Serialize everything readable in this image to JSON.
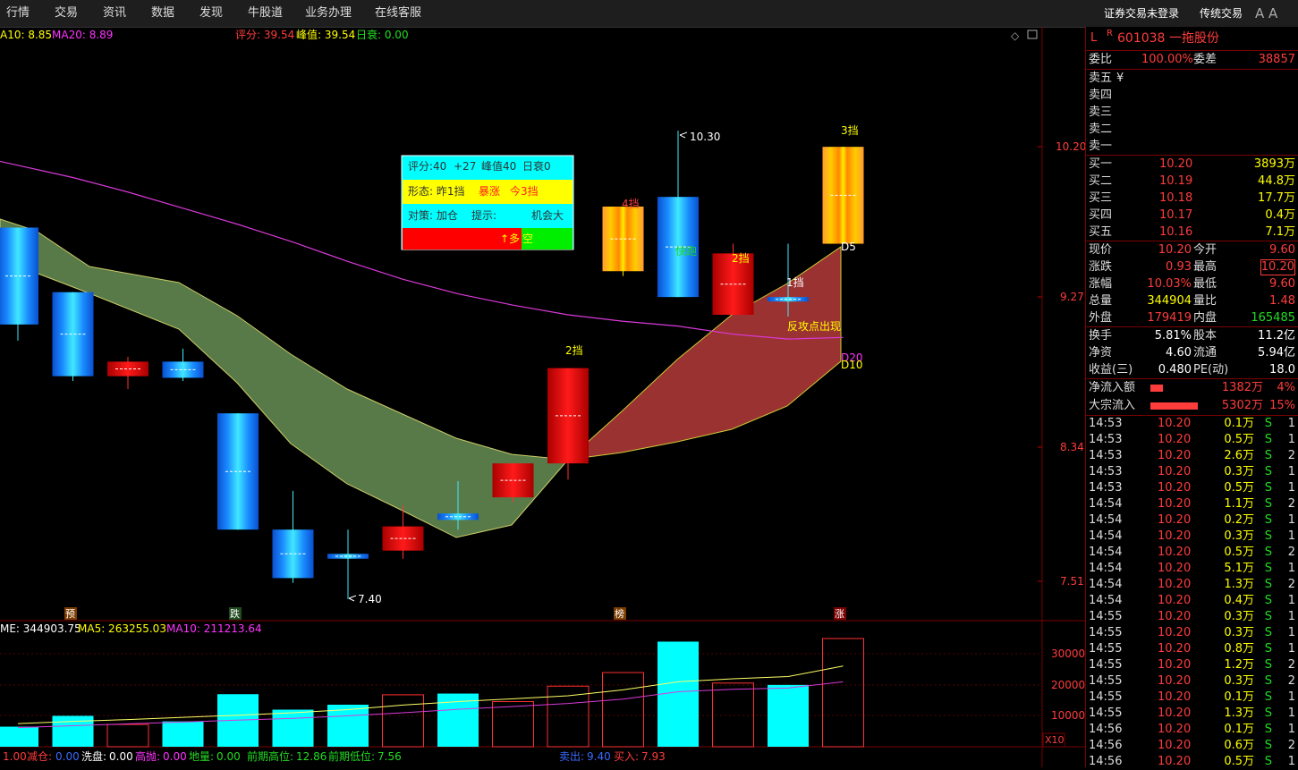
{
  "menu": [
    "行情",
    "交易",
    "资讯",
    "数据",
    "发现",
    "牛股道",
    "业务办理",
    "在线客服"
  ],
  "menu_right": {
    "login": "证券交易未登录",
    "traditional": "传统交易",
    "font": "A A"
  },
  "ma_info": {
    "ma10": "A10: 8.85",
    "ma20": "MA20: 8.89",
    "score": "评分: 39.54",
    "peak": "峰值: 39.54",
    "decay": "日衰: 0.00"
  },
  "price_axis": [
    "10.20",
    "9.27",
    "8.34",
    "7.51"
  ],
  "vol_axis": [
    "30000",
    "20000",
    "10000"
  ],
  "vol_scale": "X10",
  "high_label": "10.30",
  "low_label": "7.40",
  "popup": {
    "row1": [
      "评分:40",
      "+27",
      "峰值40",
      "日衰0"
    ],
    "row2": [
      "形态: 昨1挡",
      "暴涨",
      "今3挡"
    ],
    "row3": [
      "对策: 加仓",
      "提示:",
      "机会大"
    ],
    "row4": [
      "↑多",
      "空"
    ]
  },
  "candle_labels": {
    "c11": "4挡",
    "c12": "快跑",
    "c13": "2挡",
    "c14": "1挡",
    "c15": "3挡",
    "c10": "2挡"
  },
  "annotations": {
    "reversal": "反攻点出现",
    "d5": "D5",
    "d20": "D20",
    "d10": "D10"
  },
  "markers": [
    "预",
    "跌",
    "榜",
    "涨"
  ],
  "vol_info": {
    "vol": "ME: 344903.75",
    "ma5": "MA5: 263255.03",
    "ma10": "MA10: 211213.64"
  },
  "bottom_info": {
    "a": "1.00",
    "b_lbl": "减仓:",
    "b_val": "0.00",
    "c_lbl": "洗盘:",
    "c_val": "0.00",
    "d_lbl": "高抛:",
    "d_val": "0.00",
    "e_lbl": "地量:",
    "e_val": "0.00",
    "f_lbl": "前期高位:",
    "f_val": "12.86",
    "g_lbl": "前期低位:",
    "g_val": "7.56",
    "h_lbl": "卖出:",
    "h_val": "9.40",
    "i_lbl": "买入:",
    "i_val": "7.93"
  },
  "stock": {
    "flag": "L",
    "r": "R",
    "code": "601038",
    "name": "一拖股份"
  },
  "ratio": {
    "wb_lbl": "委比",
    "wb": "100.00%",
    "wc_lbl": "委差",
    "wc": "38857"
  },
  "sell": [
    {
      "label": "卖五",
      "extra": "¥"
    },
    {
      "label": "卖四",
      "extra": ""
    },
    {
      "label": "卖三",
      "extra": ""
    },
    {
      "label": "卖二",
      "extra": ""
    },
    {
      "label": "卖一",
      "extra": ""
    }
  ],
  "buy": [
    {
      "label": "买一",
      "price": "10.20",
      "vol": "3893万"
    },
    {
      "label": "买二",
      "price": "10.19",
      "vol": "44.8万"
    },
    {
      "label": "买三",
      "price": "10.18",
      "vol": "17.7万"
    },
    {
      "label": "买四",
      "price": "10.17",
      "vol": "0.4万"
    },
    {
      "label": "买五",
      "price": "10.16",
      "vol": "7.1万"
    }
  ],
  "quote": [
    {
      "l1": "现价",
      "v1": "10.20",
      "l2": "今开",
      "v2": "9.60"
    },
    {
      "l1": "涨跌",
      "v1": "0.93",
      "l2": "最高",
      "v2": "10.20"
    },
    {
      "l1": "涨幅",
      "v1": "10.03%",
      "l2": "最低",
      "v2": "9.60"
    },
    {
      "l1": "总量",
      "v1": "344904",
      "l2": "量比",
      "v2": "1.48"
    },
    {
      "l1": "外盘",
      "v1": "179419",
      "l2": "内盘",
      "v2": "165485"
    }
  ],
  "fin": [
    {
      "l1": "换手",
      "v1": "5.81%",
      "l2": "股本",
      "v2": "11.2亿"
    },
    {
      "l1": "净资",
      "v1": "4.60",
      "l2": "流通",
      "v2": "5.94亿"
    },
    {
      "l1": "收益(三)",
      "v1": "0.480",
      "l2": "PE(动)",
      "v2": "18.0"
    }
  ],
  "flow": [
    {
      "label": "净流入额",
      "value": "1382万",
      "pct": "4%",
      "fill": 0.25
    },
    {
      "label": "大宗流入",
      "value": "5302万",
      "pct": "15%",
      "fill": 0.95
    }
  ],
  "ticks": [
    {
      "t": "14:53",
      "p": "10.20",
      "v": "0.1万",
      "s": "S",
      "n": "1"
    },
    {
      "t": "14:53",
      "p": "10.20",
      "v": "0.5万",
      "s": "S",
      "n": "1"
    },
    {
      "t": "14:53",
      "p": "10.20",
      "v": "2.6万",
      "s": "S",
      "n": "2"
    },
    {
      "t": "14:53",
      "p": "10.20",
      "v": "0.3万",
      "s": "S",
      "n": "1"
    },
    {
      "t": "14:53",
      "p": "10.20",
      "v": "0.5万",
      "s": "S",
      "n": "1"
    },
    {
      "t": "14:54",
      "p": "10.20",
      "v": "1.1万",
      "s": "S",
      "n": "2"
    },
    {
      "t": "14:54",
      "p": "10.20",
      "v": "0.2万",
      "s": "S",
      "n": "1"
    },
    {
      "t": "14:54",
      "p": "10.20",
      "v": "0.3万",
      "s": "S",
      "n": "1"
    },
    {
      "t": "14:54",
      "p": "10.20",
      "v": "0.5万",
      "s": "S",
      "n": "2"
    },
    {
      "t": "14:54",
      "p": "10.20",
      "v": "5.1万",
      "s": "S",
      "n": "1"
    },
    {
      "t": "14:54",
      "p": "10.20",
      "v": "1.3万",
      "s": "S",
      "n": "2"
    },
    {
      "t": "14:54",
      "p": "10.20",
      "v": "0.4万",
      "s": "S",
      "n": "1"
    },
    {
      "t": "14:55",
      "p": "10.20",
      "v": "0.3万",
      "s": "S",
      "n": "1"
    },
    {
      "t": "14:55",
      "p": "10.20",
      "v": "0.3万",
      "s": "S",
      "n": "1"
    },
    {
      "t": "14:55",
      "p": "10.20",
      "v": "0.8万",
      "s": "S",
      "n": "1"
    },
    {
      "t": "14:55",
      "p": "10.20",
      "v": "1.2万",
      "s": "S",
      "n": "2"
    },
    {
      "t": "14:55",
      "p": "10.20",
      "v": "0.3万",
      "s": "S",
      "n": "2"
    },
    {
      "t": "14:55",
      "p": "10.20",
      "v": "0.1万",
      "s": "S",
      "n": "1"
    },
    {
      "t": "14:55",
      "p": "10.20",
      "v": "1.3万",
      "s": "S",
      "n": "1"
    },
    {
      "t": "14:56",
      "p": "10.20",
      "v": "0.1万",
      "s": "S",
      "n": "1"
    },
    {
      "t": "14:56",
      "p": "10.20",
      "v": "0.6万",
      "s": "S",
      "n": "2"
    },
    {
      "t": "14:56",
      "p": "10.20",
      "v": "0.5万",
      "s": "S",
      "n": "1"
    }
  ],
  "chart_data": {
    "type": "candlestick",
    "candles": [
      {
        "open": 9.1,
        "close": 9.7,
        "high": 9.7,
        "low": 9.0,
        "dir": "down",
        "style": "blue"
      },
      {
        "open": 9.3,
        "close": 8.78,
        "high": 9.3,
        "low": 8.75,
        "dir": "down",
        "style": "blue"
      },
      {
        "open": 8.87,
        "close": 8.78,
        "high": 8.9,
        "low": 8.7,
        "dir": "up",
        "style": "red"
      },
      {
        "open": 8.87,
        "close": 8.77,
        "high": 8.95,
        "low": 8.75,
        "dir": "down",
        "style": "blue"
      },
      {
        "open": 8.55,
        "close": 7.83,
        "high": 8.55,
        "low": 7.83,
        "dir": "down",
        "style": "blue"
      },
      {
        "open": 7.83,
        "close": 7.53,
        "high": 8.07,
        "low": 7.5,
        "dir": "down",
        "style": "blue"
      },
      {
        "open": 7.68,
        "close": 7.65,
        "high": 7.83,
        "low": 7.4,
        "dir": "down",
        "style": "blue"
      },
      {
        "open": 7.7,
        "close": 7.85,
        "high": 7.98,
        "low": 7.65,
        "dir": "up",
        "style": "red"
      },
      {
        "open": 7.93,
        "close": 7.89,
        "high": 8.13,
        "low": 7.83,
        "dir": "down",
        "style": "blue"
      },
      {
        "open": 8.03,
        "close": 8.24,
        "high": 8.24,
        "low": 8.0,
        "dir": "up",
        "style": "red"
      },
      {
        "open": 8.24,
        "close": 8.83,
        "high": 8.83,
        "low": 8.14,
        "dir": "up",
        "style": "red"
      },
      {
        "open": 9.43,
        "close": 9.83,
        "high": 9.83,
        "low": 9.4,
        "dir": "up",
        "style": "orange"
      },
      {
        "open": 9.89,
        "close": 9.27,
        "high": 10.3,
        "low": 9.27,
        "dir": "down",
        "style": "blue"
      },
      {
        "open": 9.16,
        "close": 9.54,
        "high": 9.6,
        "low": 9.16,
        "dir": "up",
        "style": "red"
      },
      {
        "open": 9.27,
        "close": 9.27,
        "high": 9.6,
        "low": 9.15,
        "dir": "flat",
        "style": "blue"
      },
      {
        "open": 9.6,
        "close": 10.2,
        "high": 10.2,
        "low": 9.6,
        "dir": "up",
        "style": "orange"
      }
    ],
    "ma20": [
      10.11,
      10.01,
      9.92,
      9.82,
      9.72,
      9.61,
      9.49,
      9.38,
      9.29,
      9.22,
      9.16,
      9.12,
      9.09,
      9.04,
      9.01,
      9.02
    ],
    "volume": [
      6500,
      10000,
      7200,
      8200,
      17000,
      12000,
      13600,
      16800,
      17200,
      14600,
      19600,
      24000,
      34000,
      20600,
      20000,
      35000
    ],
    "vol_ma5": [
      7500,
      8200,
      8800,
      9500,
      10200,
      11000,
      12000,
      13500,
      14600,
      15500,
      16500,
      18400,
      21000,
      22000,
      22700,
      26100
    ],
    "vol_ma10": [
      6200,
      6800,
      7400,
      8000,
      8600,
      9200,
      10000,
      11000,
      12100,
      13000,
      14000,
      15400,
      17800,
      18600,
      19000,
      21000
    ],
    "price_ylim": [
      7.3,
      10.8
    ],
    "vol_ylim": [
      0,
      40000
    ]
  }
}
